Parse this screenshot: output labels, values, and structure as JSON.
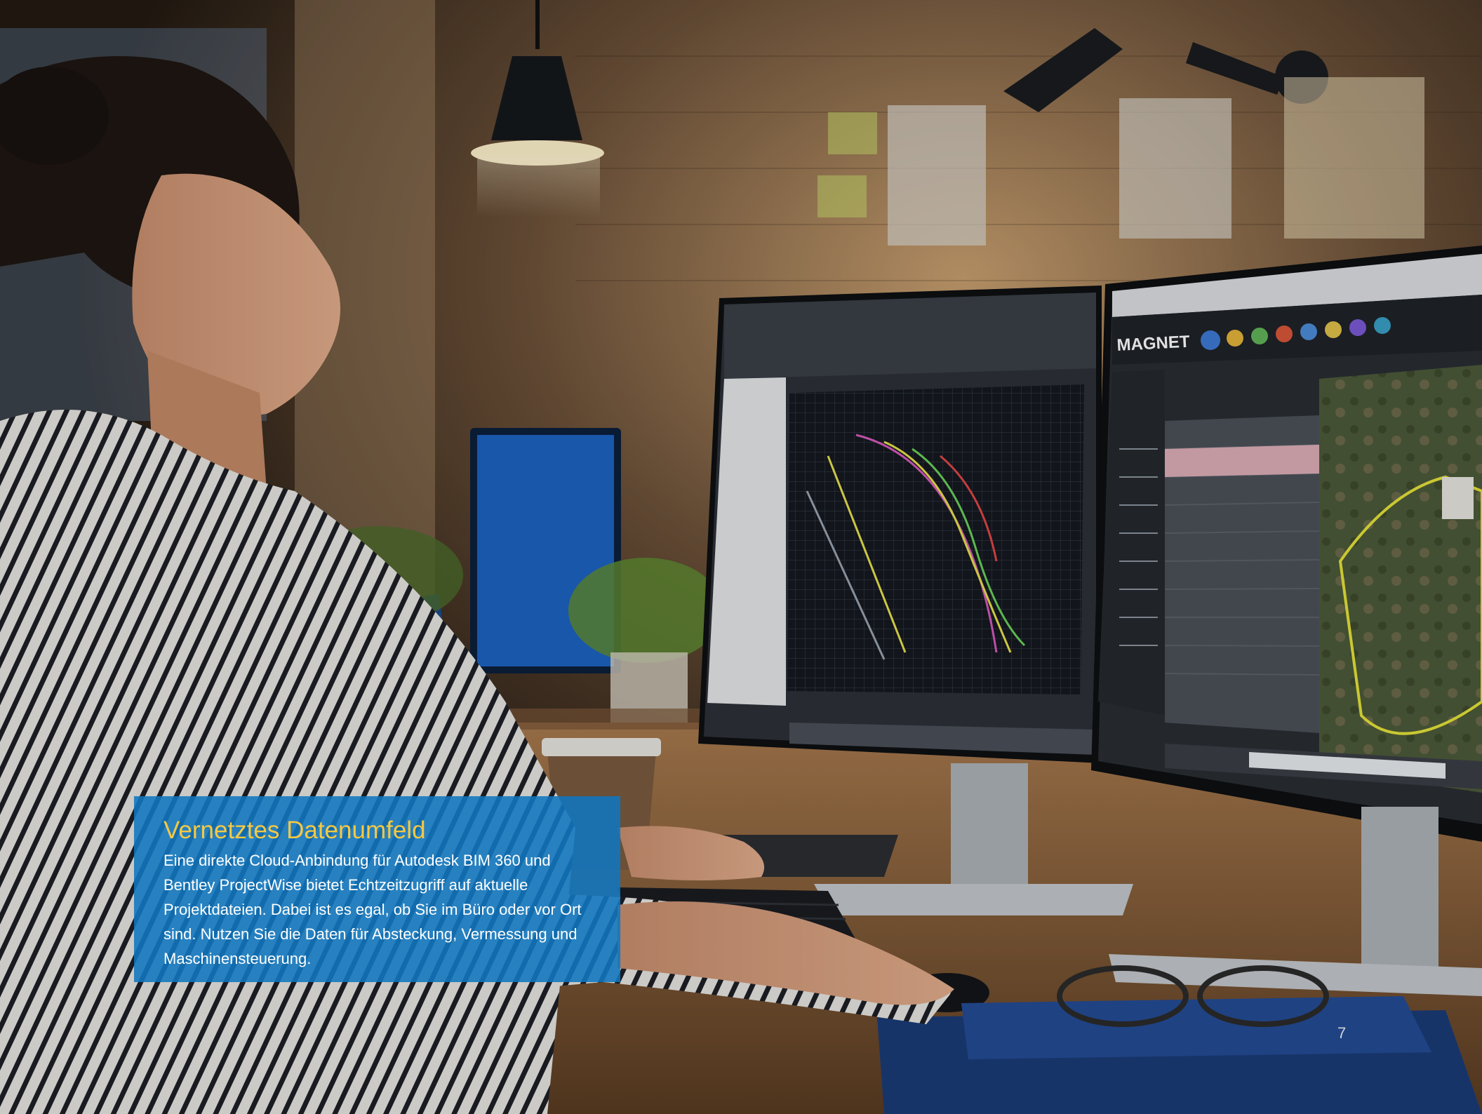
{
  "caption": {
    "title": "Vernetztes Datenumfeld",
    "body": "Eine direkte Cloud-Anbindung für Autodesk BIM 360 und Bentley ProjectWise bietet Echtzeitzugriff auf aktuelle Projektdateien. Dabei ist es egal, ob Sie im Büro oder vor Ort sind. Nutzen Sie die Daten für Absteckung, Vermessung und Maschinensteuerung."
  },
  "page_number": "7",
  "monitor_right": {
    "logo": "MAGNET"
  },
  "colors": {
    "caption_background": "#1076bf",
    "caption_title": "#f6c842",
    "caption_text": "#ffffff"
  }
}
